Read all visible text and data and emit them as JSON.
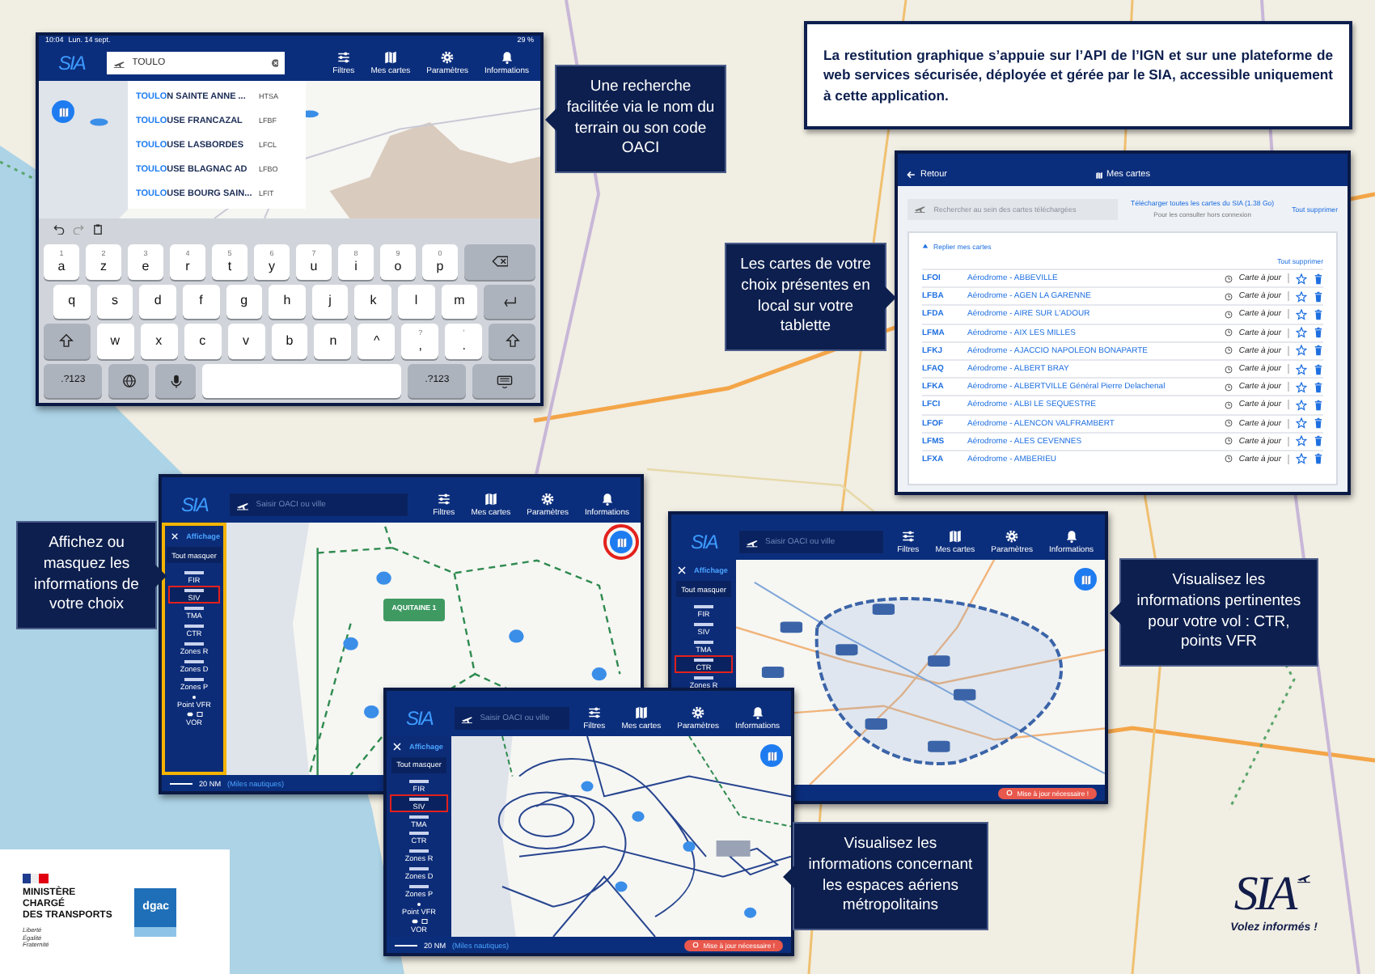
{
  "search_tablet": {
    "status": {
      "time": "10:04",
      "date": "Lun. 14 sept.",
      "battery": "29 %"
    },
    "logo": "SIA",
    "search": {
      "value": "TOULO"
    },
    "nav": [
      {
        "label": "Filtres",
        "kind": "filters"
      },
      {
        "label": "Mes cartes",
        "kind": "maps"
      },
      {
        "label": "Paramètres",
        "kind": "settings"
      },
      {
        "label": "Informations",
        "kind": "info"
      }
    ],
    "suggestions": [
      {
        "match": "TOULO",
        "rest": "N SAINTE ANNE ...",
        "code": "HTSA"
      },
      {
        "match": "TOULO",
        "rest": "USE FRANCAZAL",
        "code": "LFBF"
      },
      {
        "match": "TOULO",
        "rest": "USE LASBORDES",
        "code": "LFCL"
      },
      {
        "match": "TOULO",
        "rest": "USE BLAGNAC AD",
        "code": "LFBO"
      },
      {
        "match": "TOULO",
        "rest": "USE BOURG SAIN...",
        "code": "LFIT"
      }
    ],
    "keyboard": [
      [
        {
          "kind": "letter",
          "label": "a",
          "hint": "1"
        },
        {
          "kind": "letter",
          "label": "z",
          "hint": "2"
        },
        {
          "kind": "letter",
          "label": "e",
          "hint": "3"
        },
        {
          "kind": "letter",
          "label": "r",
          "hint": "4"
        },
        {
          "kind": "letter",
          "label": "t",
          "hint": "5"
        },
        {
          "kind": "letter",
          "label": "y",
          "hint": "6"
        },
        {
          "kind": "letter",
          "label": "u",
          "hint": "7"
        },
        {
          "kind": "letter",
          "label": "i",
          "hint": "8"
        },
        {
          "kind": "letter",
          "label": "o",
          "hint": "9"
        },
        {
          "kind": "letter",
          "label": "p",
          "hint": "0"
        },
        {
          "kind": "backspace"
        }
      ],
      [
        {
          "kind": "letter",
          "label": "q"
        },
        {
          "kind": "letter",
          "label": "s"
        },
        {
          "kind": "letter",
          "label": "d"
        },
        {
          "kind": "letter",
          "label": "f"
        },
        {
          "kind": "letter",
          "label": "g"
        },
        {
          "kind": "letter",
          "label": "h"
        },
        {
          "kind": "letter",
          "label": "j"
        },
        {
          "kind": "letter",
          "label": "k"
        },
        {
          "kind": "letter",
          "label": "l"
        },
        {
          "kind": "letter",
          "label": "m"
        },
        {
          "kind": "enter"
        }
      ],
      [
        {
          "kind": "shift"
        },
        {
          "kind": "letter",
          "label": "w"
        },
        {
          "kind": "letter",
          "label": "x"
        },
        {
          "kind": "letter",
          "label": "c"
        },
        {
          "kind": "letter",
          "label": "v"
        },
        {
          "kind": "letter",
          "label": "b"
        },
        {
          "kind": "letter",
          "label": "n"
        },
        {
          "kind": "letter",
          "label": "^"
        },
        {
          "kind": "letter",
          "label": ",",
          "hint": "?"
        },
        {
          "kind": "letter",
          "label": ".",
          "hint": "'"
        },
        {
          "kind": "shift"
        }
      ],
      [
        {
          "kind": "mode",
          "label": ".?123"
        },
        {
          "kind": "globe"
        },
        {
          "kind": "mic"
        },
        {
          "kind": "space"
        },
        {
          "kind": "mode",
          "label": ".?123"
        },
        {
          "kind": "hide"
        }
      ]
    ]
  },
  "callouts": [
    {
      "text": "Une recherche facilitée via le nom du terrain ou son code OACI"
    },
    {
      "text": "Les cartes de votre choix présentes en local sur votre tablette"
    },
    {
      "text": "Affichez ou masquez les informations de votre choix"
    },
    {
      "text": "Visualisez les informations pertinentes pour votre vol : CTR, points VFR"
    },
    {
      "text": "Visualisez les informations concernant les espaces aériens métropolitains"
    }
  ],
  "info_box": {
    "text": "La restitution graphique s’appuie sur l’API de l’IGN et sur une plateforme de web services sécurisée, déployée et gérée par le SIA, accessible uniquement à cette application."
  },
  "maps_tablet": {
    "back": "Retour",
    "title": "Mes cartes",
    "search": {
      "placeholder": "Rechercher au sein des cartes téléchargées"
    },
    "download_link": "Télécharger toutes les cartes du SIA (1.38 Go)",
    "download_note": "Pour les consulter hors connexion",
    "delete_all_top": "Tout supprimer",
    "collapse": "Replier mes cartes",
    "delete_all": "Tout supprimer",
    "rows": [
      {
        "code": "LFOI",
        "name": "Aérodrome - ABBEVILLE",
        "status": "Carte à jour",
        "favorite": false
      },
      {
        "code": "LFBA",
        "name": "Aérodrome - AGEN LA GARENNE",
        "status": "Carte à jour",
        "favorite": false
      },
      {
        "code": "LFDA",
        "name": "Aérodrome - AIRE SUR L'ADOUR",
        "status": "Carte à jour",
        "favorite": false
      },
      {
        "code": "LFMA",
        "name": "Aérodrome - AIX LES MILLES",
        "status": "Carte à jour",
        "favorite": false
      },
      {
        "code": "LFKJ",
        "name": "Aérodrome - AJACCIO NAPOLEON BONAPARTE",
        "status": "Carte à jour",
        "favorite": false
      },
      {
        "code": "LFAQ",
        "name": "Aérodrome - ALBERT BRAY",
        "status": "Carte à jour",
        "favorite": false
      },
      {
        "code": "LFKA",
        "name": "Aérodrome - ALBERTVILLE Général Pierre Delachenal",
        "status": "Carte à jour",
        "favorite": false
      },
      {
        "code": "LFCI",
        "name": "Aérodrome - ALBI LE SEQUESTRE",
        "status": "Carte à jour",
        "favorite": false
      },
      {
        "code": "LFOF",
        "name": "Aérodrome - ALENCON VALFRAMBERT",
        "status": "Carte à jour",
        "favorite": false
      },
      {
        "code": "LFMS",
        "name": "Aérodrome - ALES CEVENNES",
        "status": "Carte à jour",
        "favorite": false
      },
      {
        "code": "LFXA",
        "name": "Aérodrome - AMBERIEU",
        "status": "Carte à jour",
        "favorite": false
      }
    ]
  },
  "display_tablets": [
    {
      "logo": "SIA",
      "search": {
        "placeholder": "Saisir OACI ou ville"
      },
      "nav": [
        {
          "label": "Filtres",
          "kind": "filters"
        },
        {
          "label": "Mes cartes",
          "kind": "maps"
        },
        {
          "label": "Paramètres",
          "kind": "settings"
        },
        {
          "label": "Informations",
          "kind": "info"
        }
      ],
      "panel_title": "Affichage",
      "hide_all": "Tout masquer",
      "sidebar_outlined": true,
      "locate_outlined": true,
      "zone_label": "AQUITAINE 1",
      "scale": "20 NM",
      "scale_unit": "(Miles nautiques)",
      "layers": [
        {
          "label": "FIR",
          "kind": "line",
          "selected": false
        },
        {
          "label": "SIV",
          "kind": "line",
          "selected": true
        },
        {
          "label": "TMA",
          "kind": "line",
          "selected": false
        },
        {
          "label": "CTR",
          "kind": "line",
          "selected": false
        },
        {
          "label": "Zones R",
          "kind": "line",
          "selected": false
        },
        {
          "label": "Zones D",
          "kind": "line",
          "selected": false
        },
        {
          "label": "Zones P",
          "kind": "line",
          "selected": false
        },
        {
          "label": "Point VFR",
          "kind": "dot",
          "selected": false
        },
        {
          "label": "VOR",
          "kind": "vor",
          "selected": false
        }
      ]
    },
    {
      "logo": "SIA",
      "search": {
        "placeholder": "Saisir OACI ou ville"
      },
      "nav": [
        {
          "label": "Filtres",
          "kind": "filters"
        },
        {
          "label": "Mes cartes",
          "kind": "maps"
        },
        {
          "label": "Paramètres",
          "kind": "settings"
        },
        {
          "label": "Informations",
          "kind": "info"
        }
      ],
      "panel_title": "Affichage",
      "hide_all": "Tout masquer",
      "sidebar_outlined": false,
      "locate_outlined": false,
      "update": "Mise à jour nécessaire !",
      "layers": [
        {
          "label": "FIR",
          "kind": "line",
          "selected": false
        },
        {
          "label": "SIV",
          "kind": "line",
          "selected": false
        },
        {
          "label": "TMA",
          "kind": "line",
          "selected": false
        },
        {
          "label": "CTR",
          "kind": "line",
          "selected": true
        },
        {
          "label": "Zones R",
          "kind": "line",
          "selected": false
        }
      ]
    },
    {
      "logo": "SIA",
      "search": {
        "placeholder": "Saisir OACI ou ville"
      },
      "nav": [
        {
          "label": "Filtres",
          "kind": "filters"
        },
        {
          "label": "Mes cartes",
          "kind": "maps"
        },
        {
          "label": "Paramètres",
          "kind": "settings"
        },
        {
          "label": "Informations",
          "kind": "info"
        }
      ],
      "panel_title": "Affichage",
      "hide_all": "Tout masquer",
      "sidebar_outlined": false,
      "locate_outlined": false,
      "scale": "20 NM",
      "scale_unit": "(Miles nautiques)",
      "update": "Mise à jour nécessaire !",
      "layers": [
        {
          "label": "FIR",
          "kind": "line",
          "selected": false
        },
        {
          "label": "SIV",
          "kind": "line",
          "selected": true
        },
        {
          "label": "TMA",
          "kind": "line",
          "selected": false
        },
        {
          "label": "CTR",
          "kind": "line",
          "selected": false
        },
        {
          "label": "Zones R",
          "kind": "line",
          "selected": false
        },
        {
          "label": "Zones D",
          "kind": "line",
          "selected": false
        },
        {
          "label": "Zones P",
          "kind": "line",
          "selected": false
        },
        {
          "label": "Point VFR",
          "kind": "dot",
          "selected": false
        },
        {
          "label": "VOR",
          "kind": "vor",
          "selected": false
        }
      ]
    }
  ],
  "logos": {
    "ministry": [
      "MINISTÈRE",
      "CHARGÉ",
      "DES TRANSPORTS"
    ],
    "motto": [
      "Liberté",
      "Égalité",
      "Fraternité"
    ],
    "dgac": "dgac"
  },
  "brand": {
    "name": "SIA",
    "slogan": "Volez informés !"
  }
}
